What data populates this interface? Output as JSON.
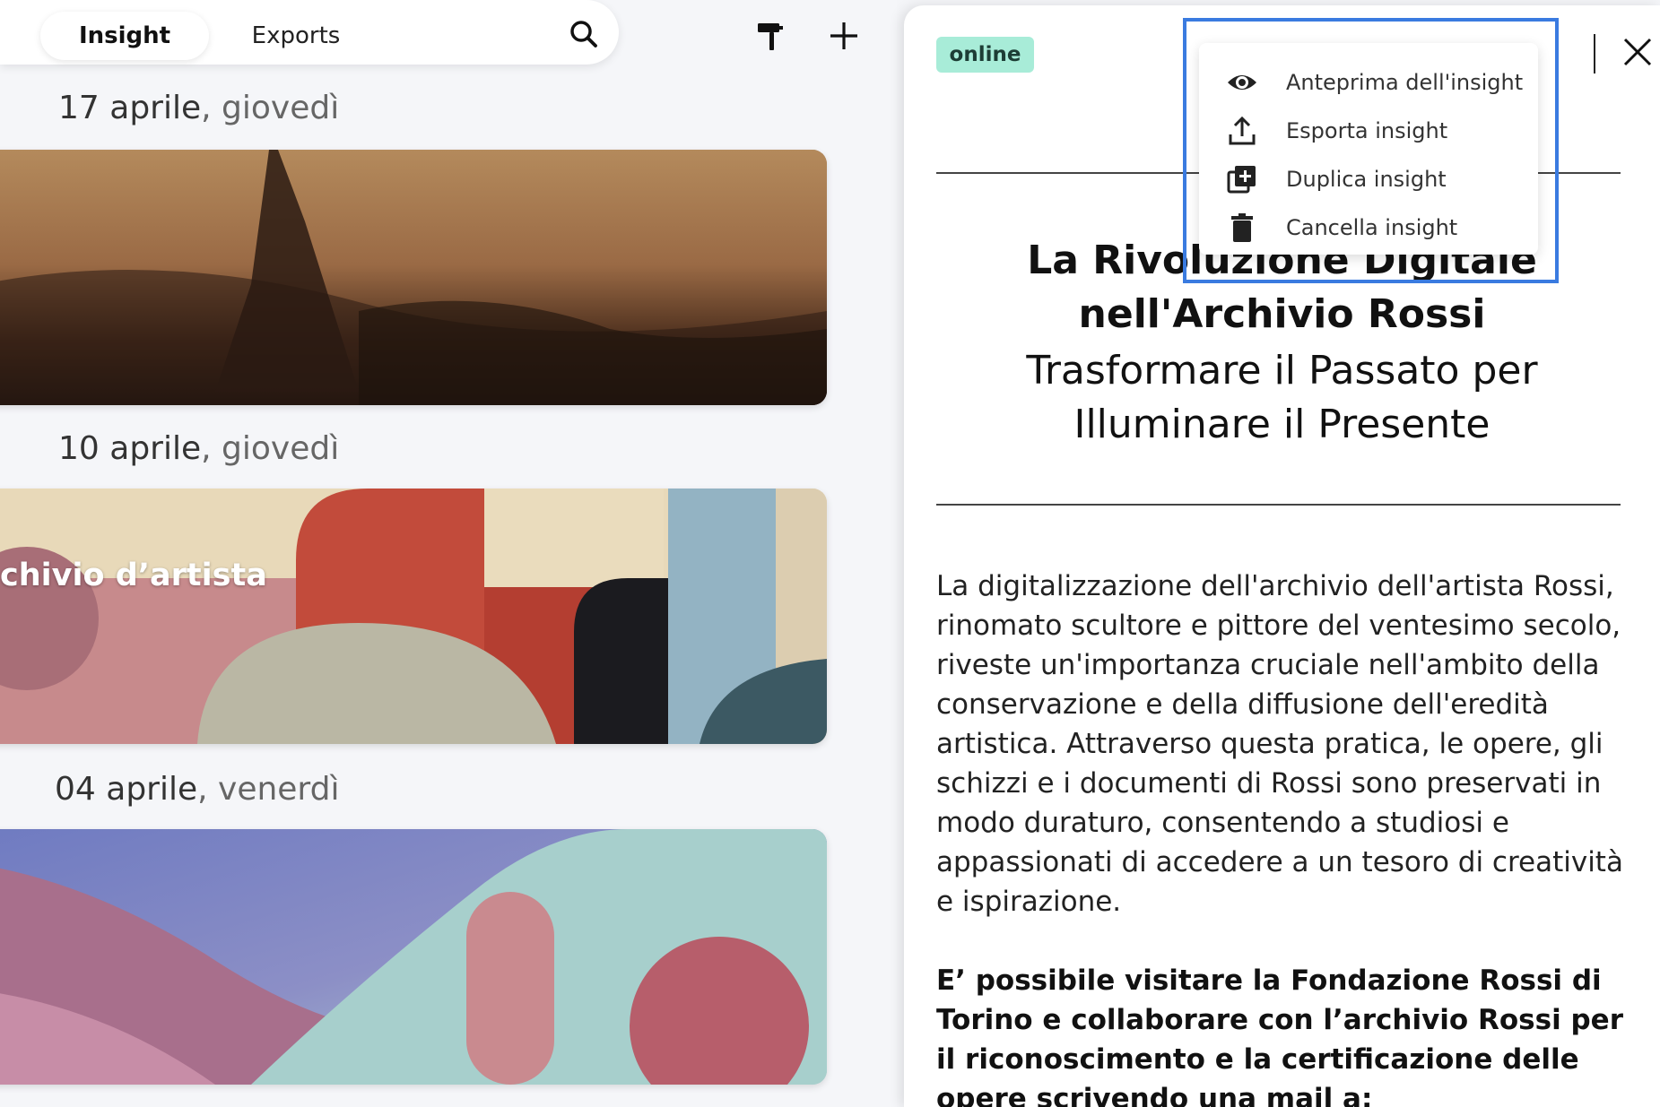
{
  "tabs": {
    "insight": "Insight",
    "exports": "Exports"
  },
  "entries": [
    {
      "date": "17 aprile",
      "weekday": ", giovedì",
      "card_title": ""
    },
    {
      "date": "10 aprile",
      "weekday": ", giovedì",
      "card_title": "chivio d’artista"
    },
    {
      "date": "04 aprile",
      "weekday": ", venerdì",
      "card_title": ""
    }
  ],
  "detail": {
    "status": "online",
    "title": "La Rivoluzione Digitale nell'Archivio Rossi",
    "subtitle": "Trasformare il Passato per Illuminare il Presente",
    "body": "La digitalizzazione dell'archivio dell'artista Rossi, rinomato scultore e pittore del ventesimo secolo, riveste un'importanza cruciale nell'ambito della conservazione e della diffusione dell'eredità artistica. Attraverso questa pratica, le opere, gli schizzi e i documenti di Rossi sono preservati in modo duraturo, consentendo a studiosi e appassionati di accedere a un tesoro di creatività e ispirazione.",
    "body_bold": "E’ possibile visitare la Fondazione Rossi di Torino e collaborare con l’archivio Rossi per il riconoscimento e la certificazione delle opere scrivendo una mail a: info@archiviorossi.it"
  },
  "menu": {
    "items": [
      {
        "label": "Anteprima dell'insight",
        "icon": "eye-icon"
      },
      {
        "label": "Esporta insight",
        "icon": "upload-icon"
      },
      {
        "label": "Duplica insight",
        "icon": "duplicate-icon"
      },
      {
        "label": "Cancella insight",
        "icon": "trash-icon"
      }
    ]
  },
  "colors": {
    "status_bg": "#a8ecd8",
    "highlight": "#3a7be0"
  }
}
